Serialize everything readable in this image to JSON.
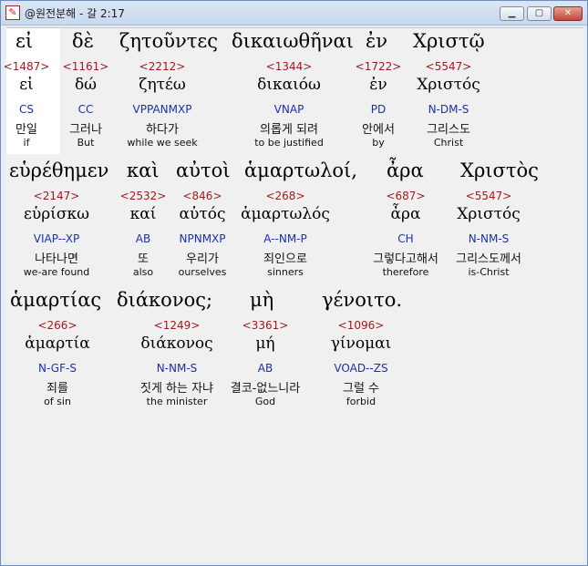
{
  "window": {
    "title": "@원전분해 - 갈 2:17",
    "app_icon": "edit-icon",
    "buttons": {
      "minimize": "▁",
      "maximize": "▢",
      "close": "✕"
    }
  },
  "rows": [
    {
      "greek": [
        "εἰ",
        "δὲ",
        "ζητοῦντες",
        "δικαιωθῆναι",
        "ἐν",
        "Χριστῷ"
      ],
      "words": [
        {
          "strong": "<1487>",
          "lemma": "εἰ",
          "parse": "CS",
          "kor": "만일",
          "eng": "if"
        },
        {
          "strong": "<1161>",
          "lemma": "δώ",
          "parse": "CC",
          "kor": "그러나",
          "eng": "But"
        },
        {
          "strong": "<2212>",
          "lemma": "ζητέω",
          "parse": "VPPANMXP",
          "kor": "하다가",
          "eng": "while we seek"
        },
        {
          "strong": "<1344>",
          "lemma": "δικαιόω",
          "parse": "VNAP",
          "kor": "의롭게 되려",
          "eng": "to be justified"
        },
        {
          "strong": "<1722>",
          "lemma": "ἐν",
          "parse": "PD",
          "kor": "안에서",
          "eng": "by"
        },
        {
          "strong": "<5547>",
          "lemma": "Χριστός",
          "parse": "N-DM-S",
          "kor": "그리스도",
          "eng": "Christ"
        }
      ]
    },
    {
      "greek": [
        "εὑρέθημεν",
        "καὶ",
        "αὐτοὶ",
        "ἁμαρτωλοί,",
        "ἆρα",
        "Χριστὸς"
      ],
      "words": [
        {
          "strong": "<2147>",
          "lemma": "εὑρίσκω",
          "parse": "VIAP--XP",
          "kor": "나타나면",
          "eng": "we-are found"
        },
        {
          "strong": "<2532>",
          "lemma": "καί",
          "parse": "AB",
          "kor": "또",
          "eng": "also"
        },
        {
          "strong": "<846>",
          "lemma": "αὐτός",
          "parse": "NPNMXP",
          "kor": "우리가",
          "eng": "ourselves"
        },
        {
          "strong": "<268>",
          "lemma": "ἁμαρτωλός",
          "parse": "A--NM-P",
          "kor": "죄인으로",
          "eng": "sinners"
        },
        {
          "strong": "<687>",
          "lemma": "ἆρα",
          "parse": "CH",
          "kor": "그렇다고해서",
          "eng": "therefore"
        },
        {
          "strong": "<5547>",
          "lemma": "Χριστός",
          "parse": "N-NM-S",
          "kor": "그리스도께서",
          "eng": "is-Christ"
        }
      ]
    },
    {
      "greek": [
        "ἁμαρτίας",
        "διάκονος;",
        "μὴ",
        "γένοιτο."
      ],
      "words": [
        {
          "strong": "<266>",
          "lemma": "ἁμαρτία",
          "parse": "N-GF-S",
          "kor": "죄를",
          "eng": "of sin"
        },
        {
          "strong": "<1249>",
          "lemma": "διάκονος",
          "parse": "N-NM-S",
          "kor": "짓게 하는 자냐",
          "eng": "the minister"
        },
        {
          "strong": "<3361>",
          "lemma": "μή",
          "parse": "AB",
          "kor": "결코-없느니라",
          "eng": "God"
        },
        {
          "strong": "<1096>",
          "lemma": "γίνομαι",
          "parse": "VOAD--ZS",
          "kor": "그럴 수",
          "eng": "forbid"
        }
      ]
    }
  ]
}
